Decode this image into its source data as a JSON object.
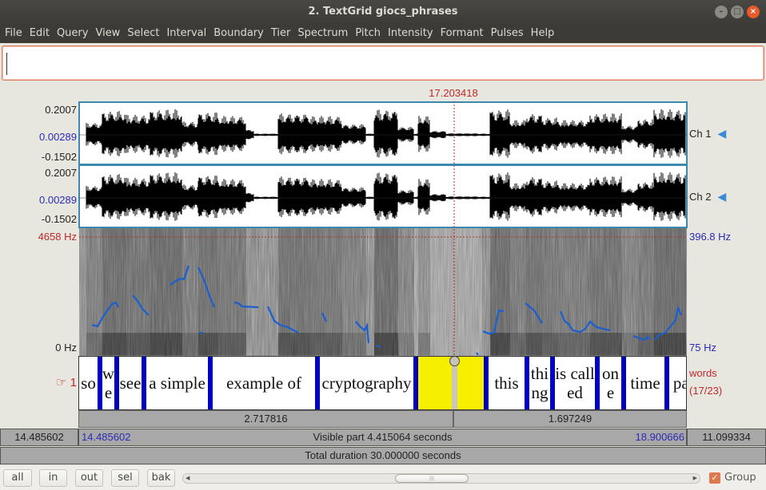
{
  "window": {
    "title": "2. TextGrid giocs_phrases",
    "buttons": [
      "minimize",
      "maximize",
      "close"
    ]
  },
  "menu": [
    "File",
    "Edit",
    "Query",
    "View",
    "Select",
    "Interval",
    "Boundary",
    "Tier",
    "Spectrum",
    "Pitch",
    "Intensity",
    "Formant",
    "Pulses",
    "Help"
  ],
  "text_field": {
    "value": ""
  },
  "cursor": {
    "time_label": "17.203418",
    "time_s": 17.203418
  },
  "waveform": {
    "channels": [
      {
        "name": "Ch 1",
        "max": "0.2007",
        "zero": "0.00289",
        "min": "-0.1502"
      },
      {
        "name": "Ch 2",
        "max": "0.2007",
        "zero": "0.00289",
        "min": "-0.1502"
      }
    ],
    "speaker_icon": "speaker-icon"
  },
  "spectrogram": {
    "top_freq": "4658 Hz",
    "bottom_freq": "0 Hz",
    "pitch_top": "396.8 Hz",
    "pitch_bottom": "75 Hz"
  },
  "tier": {
    "number_label": "1",
    "pointer_icon": "☞",
    "name": "words",
    "count": "(17/23)",
    "intervals": [
      {
        "text": "so",
        "selected": false
      },
      {
        "text": "we",
        "selected": false
      },
      {
        "text": "see",
        "selected": false
      },
      {
        "text": "a simple",
        "selected": false
      },
      {
        "text": "example of",
        "selected": false
      },
      {
        "text": "cryptography",
        "selected": false
      },
      {
        "text": "",
        "selected": true
      },
      {
        "text": "this",
        "selected": false
      },
      {
        "text": "thing",
        "selected": false
      },
      {
        "text": "is called",
        "selected": false
      },
      {
        "text": "one",
        "selected": false
      },
      {
        "text": "time",
        "selected": false
      },
      {
        "text": "pad",
        "selected": false
      }
    ]
  },
  "durations": {
    "left": "2.717816",
    "right": "1.697249"
  },
  "visible": {
    "before": "14.485602",
    "start": "14.485602",
    "label": "Visible part 4.415064 seconds",
    "end": "18.900666",
    "after": "11.099334"
  },
  "total": {
    "label": "Total duration 30.000000 seconds"
  },
  "bottom": {
    "buttons": [
      "all",
      "in",
      "out",
      "sel",
      "bak"
    ],
    "scroll_position": 0.48,
    "group_label": "Group",
    "group_checked": true
  }
}
